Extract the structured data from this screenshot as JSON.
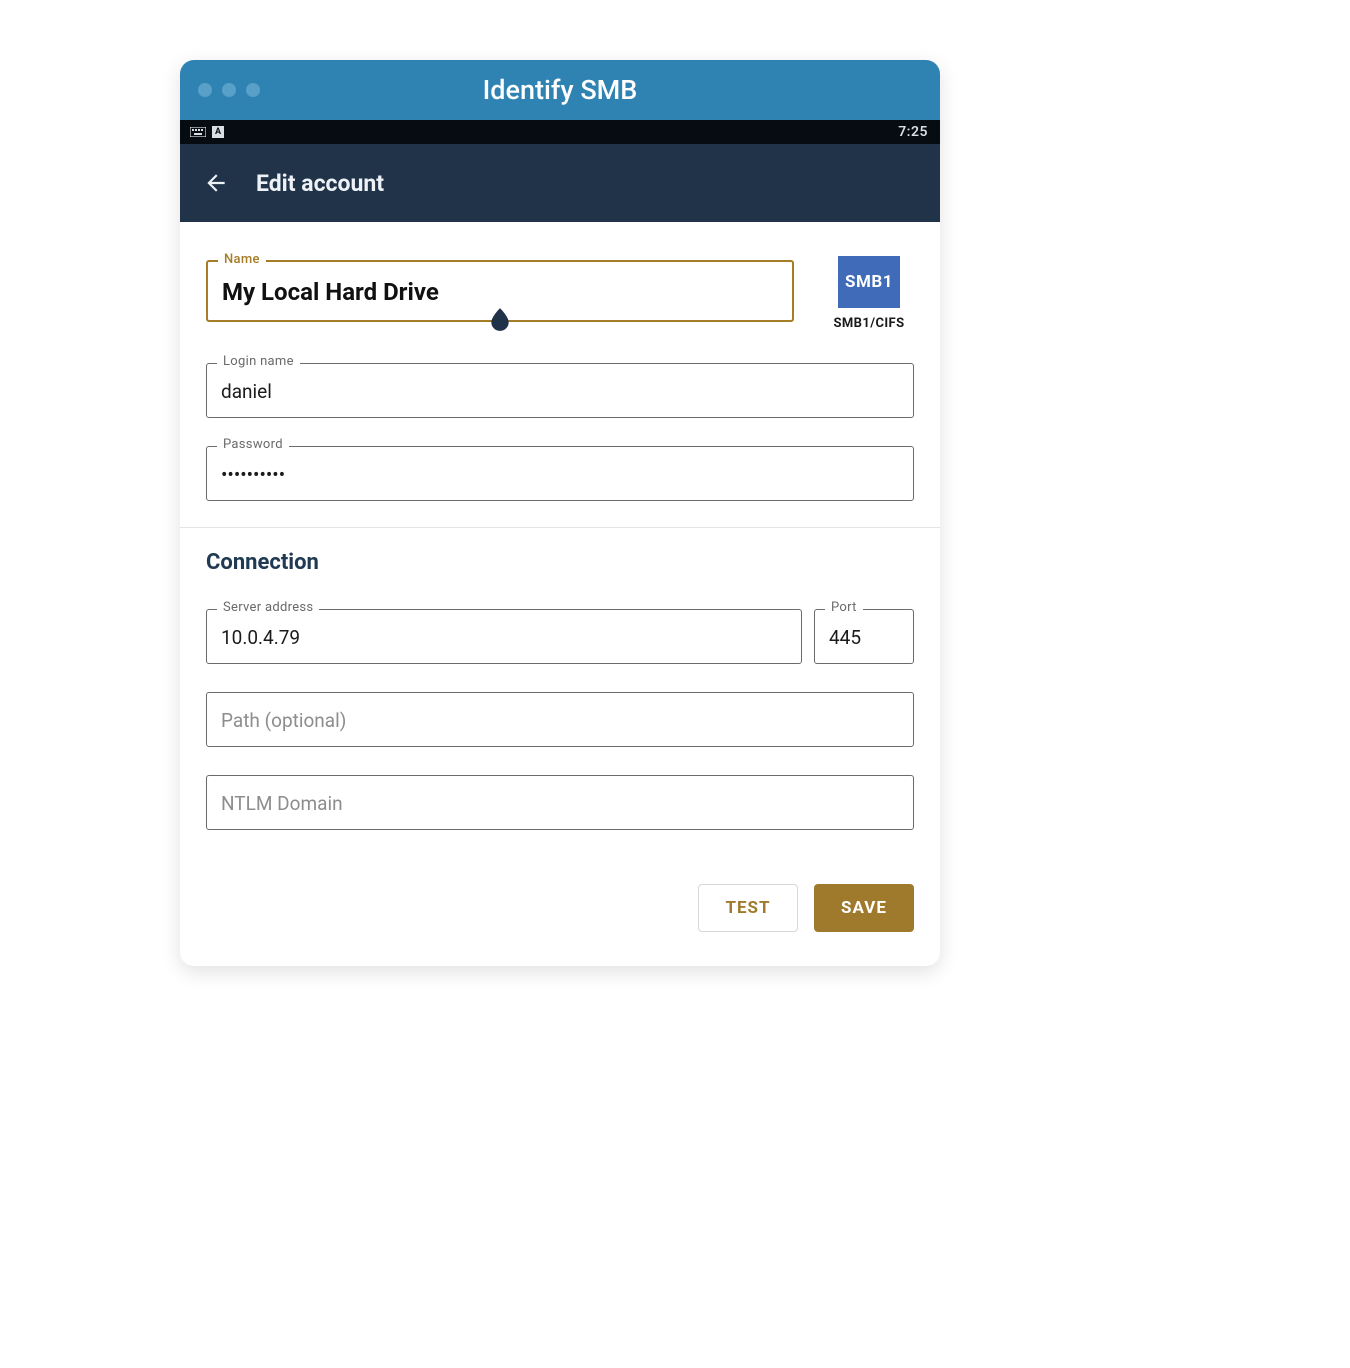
{
  "window": {
    "title": "Identify SMB"
  },
  "statusbar": {
    "time": "7:25"
  },
  "appbar": {
    "title": "Edit account"
  },
  "account": {
    "name_label": "Name",
    "name_value": "My Local Hard Drive",
    "login_label": "Login name",
    "login_value": "daniel",
    "password_label": "Password",
    "password_value": "••••••••••"
  },
  "protocol": {
    "badge": "SMB1",
    "label": "SMB1/CIFS"
  },
  "connection": {
    "section_title": "Connection",
    "server_label": "Server address",
    "server_value": "10.0.4.79",
    "port_label": "Port",
    "port_value": "445",
    "path_placeholder": "Path (optional)",
    "path_value": "",
    "ntlm_placeholder": "NTLM Domain",
    "ntlm_value": ""
  },
  "actions": {
    "test_label": "TEST",
    "save_label": "SAVE"
  }
}
